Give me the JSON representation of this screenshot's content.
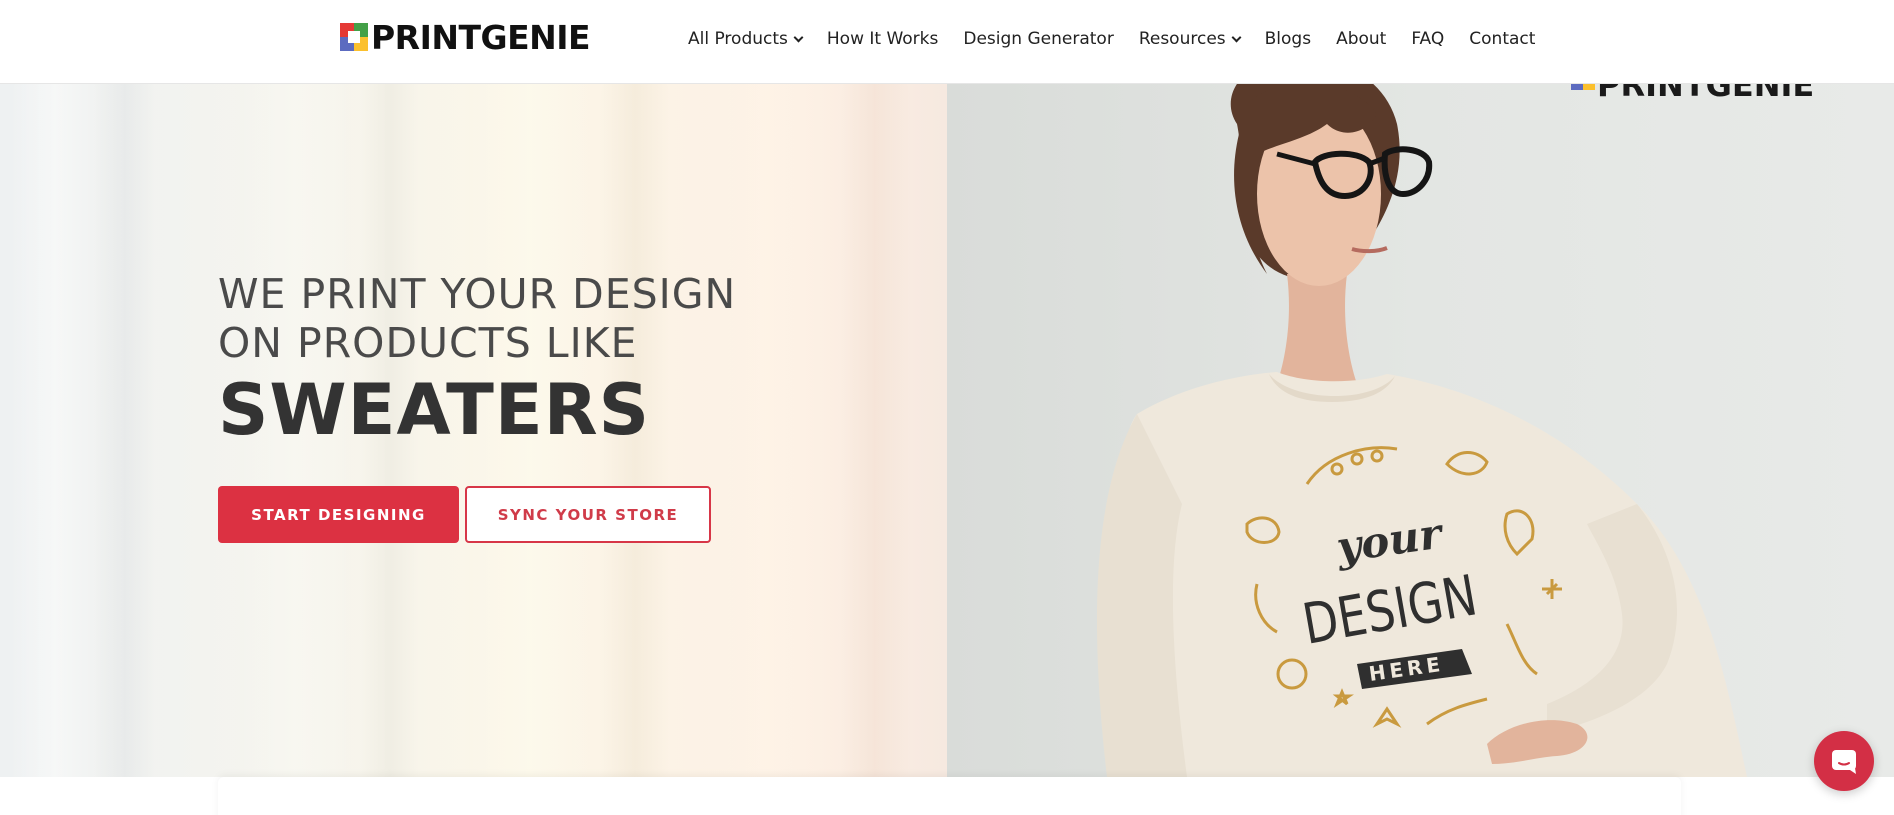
{
  "brand": {
    "name": "PRINTGENIE"
  },
  "nav": {
    "items": [
      {
        "label": "All Products",
        "dropdown": true
      },
      {
        "label": "How It Works",
        "dropdown": false
      },
      {
        "label": "Design Generator",
        "dropdown": false
      },
      {
        "label": "Resources",
        "dropdown": true
      },
      {
        "label": "Blogs",
        "dropdown": false
      },
      {
        "label": "About",
        "dropdown": false
      },
      {
        "label": "FAQ",
        "dropdown": false
      },
      {
        "label": "Contact",
        "dropdown": false
      }
    ]
  },
  "hero": {
    "line1": "WE PRINT YOUR DESIGN",
    "line2": "ON PRODUCTS LIKE",
    "product": "SWEATERS",
    "primary_button": "START DESIGNING",
    "secondary_button": "SYNC YOUR STORE",
    "image_watermark": "PRINTGENIE",
    "shirt_print": {
      "word1": "your",
      "word2": "DESIGN",
      "word3": "HERE"
    }
  },
  "colors": {
    "accent": "#dc3142",
    "text_dark": "#333333",
    "sweater": "#efe8dc",
    "print_gold": "#c99a3f"
  },
  "icons": [
    "chevron-down-icon",
    "chat-icon",
    "logo-mark-icon"
  ]
}
